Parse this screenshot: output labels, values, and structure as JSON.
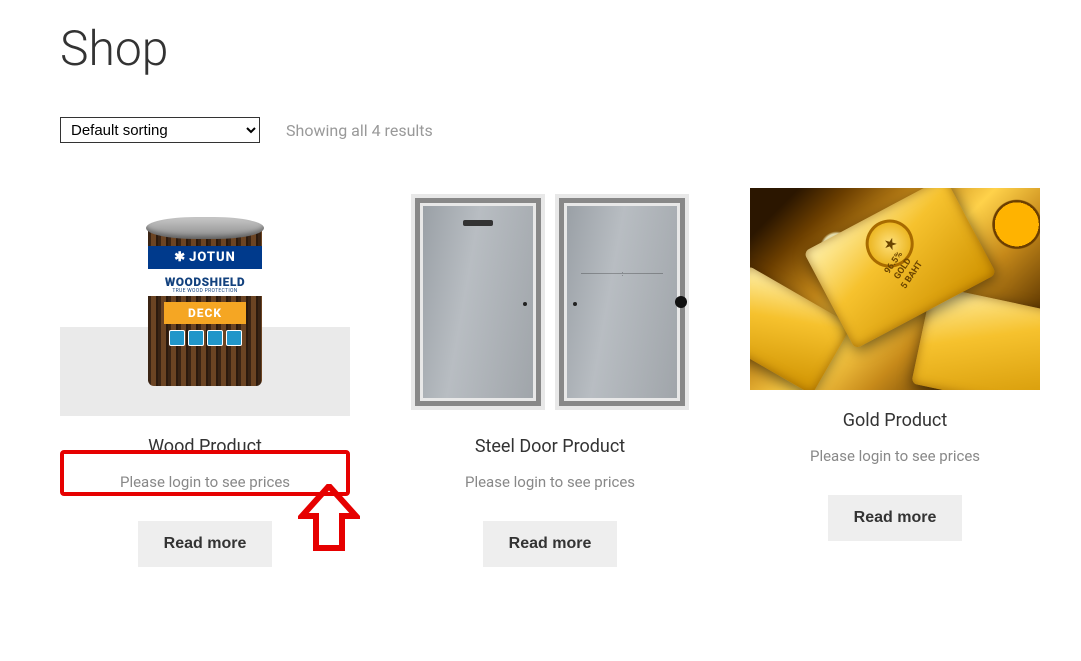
{
  "page": {
    "title": "Shop"
  },
  "sorting": {
    "selected": "Default sorting",
    "options": [
      "Default sorting"
    ]
  },
  "results_text": "Showing all 4 results",
  "labels": {
    "price_notice": "Please login to see prices",
    "read_more": "Read more"
  },
  "products": [
    {
      "title": "Wood Product"
    },
    {
      "title": "Steel Door Product"
    },
    {
      "title": "Gold Product"
    }
  ],
  "wood_can": {
    "brand_glyph": "✱",
    "brand": "JOTUN",
    "line": "WOODSHIELD",
    "tagline": "TRUE WOOD PROTECTION",
    "variant": "DECK"
  },
  "gold_bar": {
    "purity": "96.5%",
    "word": "GOLD",
    "weight": "5 BAHT"
  }
}
